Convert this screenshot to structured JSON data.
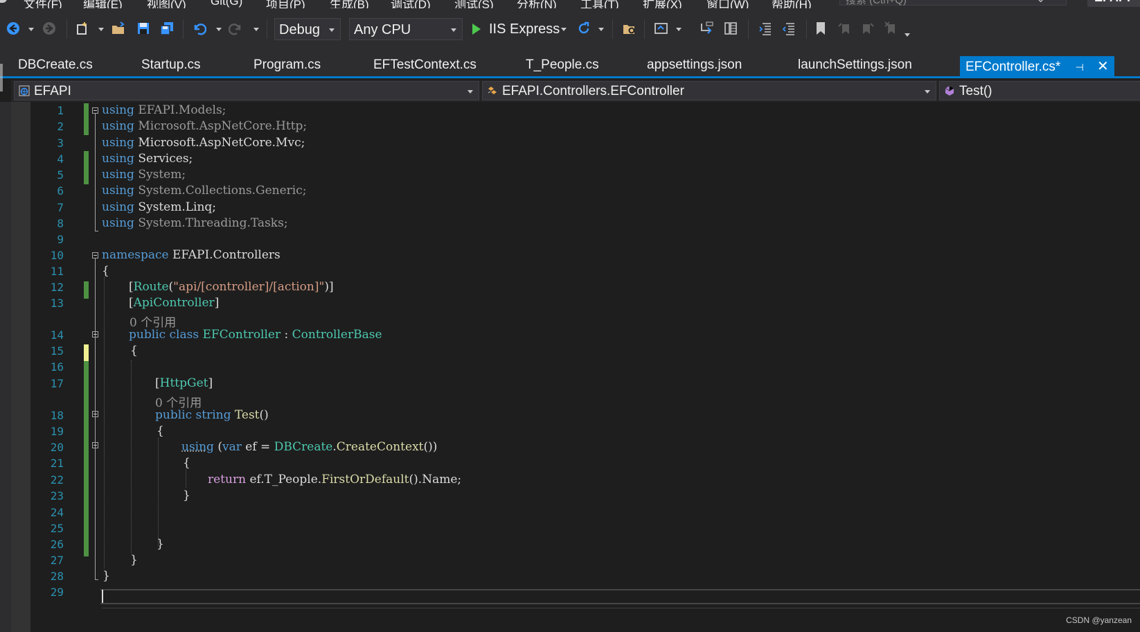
{
  "menu": {
    "items": [
      "文件(F)",
      "编辑(E)",
      "视图(V)",
      "Git(G)",
      "项目(P)",
      "生成(B)",
      "调试(D)",
      "测试(S)",
      "分析(N)",
      "工具(T)",
      "扩展(X)",
      "窗口(W)",
      "帮助(H)"
    ],
    "search_placeholder": "搜索 (Ctrl+Q)",
    "solution_name": "EFAPI"
  },
  "toolbar": {
    "config": "Debug",
    "platform": "Any CPU",
    "run_target": "IIS Express",
    "icons": [
      "back-icon",
      "forward-icon",
      "new-project-icon",
      "open-folder-icon",
      "save-icon",
      "save-all-icon",
      "undo-icon",
      "redo-icon",
      "restart-icon",
      "find-in-files-icon",
      "browser-link-icon",
      "step-into-icon",
      "step-over-icon",
      "outdent-icon",
      "indent-icon",
      "bookmark-icon",
      "prev-bookmark-icon",
      "next-bookmark-icon",
      "clear-bookmarks-icon"
    ]
  },
  "tabs": [
    {
      "label": "DBCreate.cs"
    },
    {
      "label": "Startup.cs"
    },
    {
      "label": "Program.cs"
    },
    {
      "label": "EFTestContext.cs"
    },
    {
      "label": "T_People.cs"
    },
    {
      "label": "appsettings.json"
    },
    {
      "label": "launchSettings.json"
    },
    {
      "label": "EFController.cs*",
      "active": true
    }
  ],
  "navbar": {
    "project": "EFAPI",
    "type": "EFAPI.Controllers.EFController",
    "member": "Test()"
  },
  "editor": {
    "line_numbers": [
      "1",
      "2",
      "3",
      "4",
      "5",
      "6",
      "7",
      "8",
      "9",
      "10",
      "11",
      "12",
      "13",
      "14",
      "15",
      "16",
      "17",
      "18",
      "19",
      "20",
      "21",
      "22",
      "23",
      "24",
      "25",
      "26",
      "27",
      "28",
      "29"
    ],
    "reference_hint": "0 个引用",
    "lines": {
      "l1": [
        "using",
        " EFAPI.Models;"
      ],
      "l2": [
        "using",
        " Microsoft.AspNetCore.Http;"
      ],
      "l3": [
        "using",
        " Microsoft.AspNetCore.Mvc;"
      ],
      "l4": [
        "using",
        " Services;"
      ],
      "l5": [
        "using",
        " System;"
      ],
      "l6": [
        "using",
        " System.Collections.Generic;"
      ],
      "l7": [
        "using",
        " System.Linq;"
      ],
      "l8": [
        "using",
        " System.Threading.Tasks;"
      ],
      "l10": [
        "namespace",
        " EFAPI.Controllers"
      ],
      "l11": "{",
      "l12": [
        "[",
        "Route",
        "(",
        "\"api/[controller]/[action]\"",
        ")]"
      ],
      "l13": [
        "[",
        "ApiController",
        "]"
      ],
      "l14": [
        "public",
        " ",
        "class",
        " ",
        "EFController",
        " : ",
        "ControllerBase"
      ],
      "l15": "{",
      "l17": [
        "[",
        "HttpGet",
        "]"
      ],
      "l18": [
        "public",
        " ",
        "string",
        " ",
        "Test",
        "()"
      ],
      "l19": "{",
      "l20": [
        "using",
        " (",
        "var",
        " ef = ",
        "DBCreate",
        ".",
        "CreateContext",
        "())"
      ],
      "l21": "{",
      "l22": [
        "return",
        " ef.T_People.",
        "FirstOrDefault",
        "().Name;"
      ],
      "l23": "}",
      "l26": "}",
      "l27": "}",
      "l28": "}"
    }
  },
  "watermark": "CSDN @yanzean",
  "colors": {
    "keyword": "#569cd6",
    "type": "#4ec9b0",
    "string": "#d69d85",
    "method": "#dcdcaa",
    "line_number": "#2b91af",
    "accent": "#007acc"
  }
}
